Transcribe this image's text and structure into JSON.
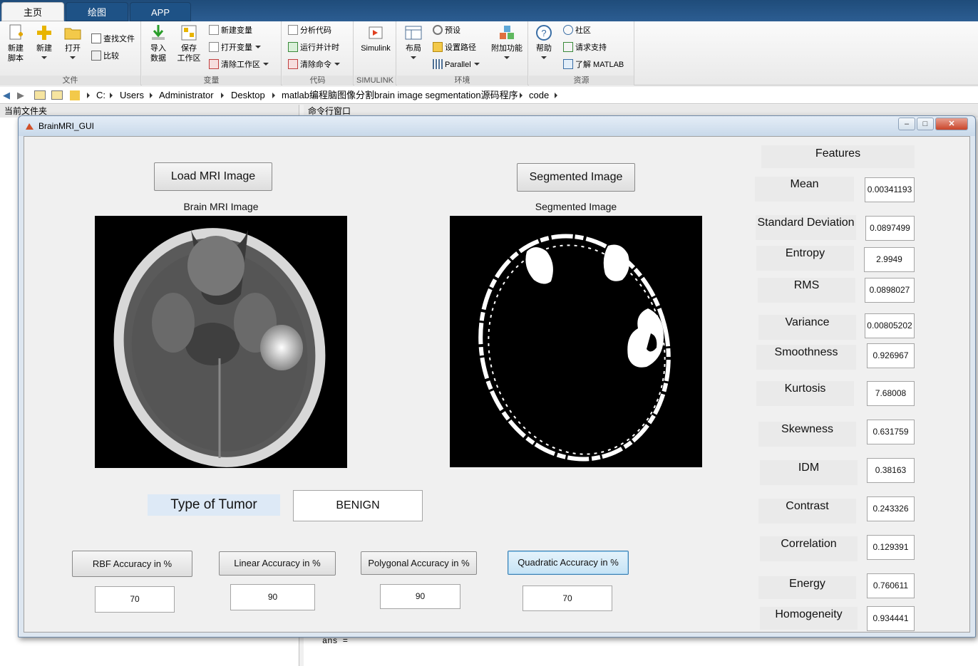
{
  "matlab": {
    "tabs": [
      "主页",
      "绘图",
      "APP"
    ],
    "ribbon": {
      "file": {
        "label": "文件",
        "new_script": "新建\n脚本",
        "new": "新建",
        "open": "打开",
        "find_files": "查找文件",
        "compare": "比较"
      },
      "variable": {
        "label": "变量",
        "import": "导入\n数据",
        "save_ws": "保存\n工作区",
        "new_var": "新建变量",
        "open_var": "打开变量",
        "clear_ws": "清除工作区"
      },
      "code": {
        "label": "代码",
        "analyze": "分析代码",
        "run_time": "运行并计时",
        "clear_cmd": "清除命令"
      },
      "simulink": {
        "label": "SIMULINK",
        "simulink": "Simulink"
      },
      "env": {
        "label": "环境",
        "layout": "布局",
        "prefs": "预设",
        "set_path": "设置路径",
        "parallel": "Parallel",
        "addons": "附加功能"
      },
      "resources": {
        "label": "资源",
        "help": "帮助",
        "community": "社区",
        "support": "请求支持",
        "learn": "了解 MATLAB"
      }
    },
    "path": [
      "C:",
      "Users",
      "Administrator",
      "Desktop",
      "matlab编程脑图像分割brain image segmentation源码程序",
      "code"
    ],
    "current_folder_title": "当前文件夹",
    "command_window_title": "命令行窗口",
    "command_output": "ans ="
  },
  "gui": {
    "title": "BrainMRI_GUI",
    "load_button": "Load MRI Image",
    "segment_button": "Segmented Image",
    "brain_label": "Brain MRI Image",
    "segmented_label": "Segmented Image",
    "tumor_type_label": "Type of Tumor",
    "tumor_type_value": "BENIGN",
    "accuracy": [
      {
        "label": "RBF Accuracy in %",
        "value": "70"
      },
      {
        "label": "Linear Accuracy in %",
        "value": "90"
      },
      {
        "label": "Polygonal Accuracy in %",
        "value": "90"
      },
      {
        "label": "Quadratic Accuracy in %",
        "value": "70"
      }
    ],
    "features_title": "Features",
    "features": [
      {
        "name": "Mean",
        "value": "0.00341193"
      },
      {
        "name": "Standard Deviation",
        "value": "0.0897499"
      },
      {
        "name": "Entropy",
        "value": "2.9949"
      },
      {
        "name": "RMS",
        "value": "0.0898027"
      },
      {
        "name": "Variance",
        "value": "0.00805202"
      },
      {
        "name": "Smoothness",
        "value": "0.926967"
      },
      {
        "name": "Kurtosis",
        "value": "7.68008"
      },
      {
        "name": "Skewness",
        "value": "0.631759"
      },
      {
        "name": "IDM",
        "value": "0.38163"
      },
      {
        "name": "Contrast",
        "value": "0.243326"
      },
      {
        "name": "Correlation",
        "value": "0.129391"
      },
      {
        "name": "Energy",
        "value": "0.760611"
      },
      {
        "name": "Homogeneity",
        "value": "0.934441"
      }
    ]
  }
}
